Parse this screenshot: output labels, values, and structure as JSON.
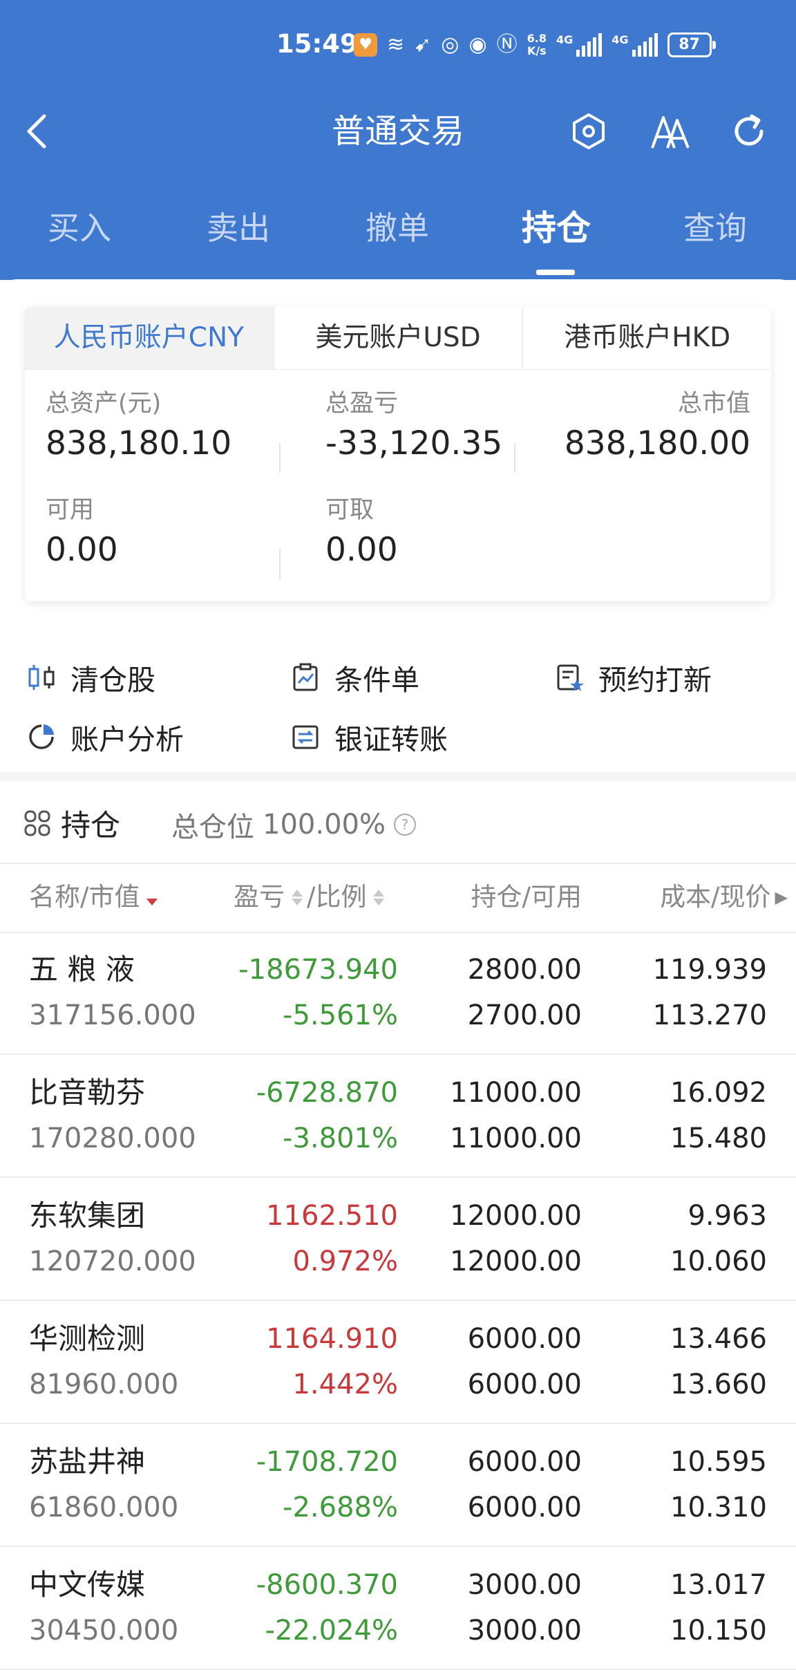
{
  "status_bar": {
    "time": "15:49",
    "net_speed_value": "6.8",
    "net_speed_unit": "K/s",
    "net_4g_1": "4G",
    "net_4g_2": "4G",
    "battery": "87"
  },
  "header": {
    "title": "普通交易"
  },
  "tabs": [
    {
      "label": "买入",
      "active": false
    },
    {
      "label": "卖出",
      "active": false
    },
    {
      "label": "撤单",
      "active": false
    },
    {
      "label": "持仓",
      "active": true
    },
    {
      "label": "查询",
      "active": false
    }
  ],
  "account_tabs": [
    {
      "label": "人民币账户CNY",
      "active": true
    },
    {
      "label": "美元账户USD",
      "active": false
    },
    {
      "label": "港币账户HKD",
      "active": false
    }
  ],
  "summary": {
    "total_assets_label": "总资产(元)",
    "total_assets": "838,180.10",
    "total_pl_label": "总盈亏",
    "total_pl": "-33,120.35",
    "market_value_label": "总市值",
    "market_value": "838,180.00",
    "available_label": "可用",
    "available": "0.00",
    "withdrawable_label": "可取",
    "withdrawable": "0.00"
  },
  "shortcuts": {
    "clear_stock": "清仓股",
    "conditional_order": "条件单",
    "ipo_subscribe": "预约打新",
    "account_analysis": "账户分析",
    "bank_transfer": "银证转账"
  },
  "positions": {
    "title": "持仓",
    "total_label": "总仓位",
    "total_value": "100.00%",
    "columns": {
      "name_mv": "名称/市值",
      "pl": "盈亏",
      "ratio": "/比例",
      "hold_avail": "持仓/可用",
      "cost_price": "成本/现价"
    },
    "rows": [
      {
        "name": "五 粮 液",
        "market_value": "317156.000",
        "pl": "-18673.940",
        "pct": "-5.561%",
        "hold": "2800.00",
        "avail": "2700.00",
        "cost": "119.939",
        "price": "113.270",
        "sign": "neg"
      },
      {
        "name": "比音勒芬",
        "market_value": "170280.000",
        "pl": "-6728.870",
        "pct": "-3.801%",
        "hold": "11000.00",
        "avail": "11000.00",
        "cost": "16.092",
        "price": "15.480",
        "sign": "neg"
      },
      {
        "name": "东软集团",
        "market_value": "120720.000",
        "pl": "1162.510",
        "pct": "0.972%",
        "hold": "12000.00",
        "avail": "12000.00",
        "cost": "9.963",
        "price": "10.060",
        "sign": "pos"
      },
      {
        "name": "华测检测",
        "market_value": "81960.000",
        "pl": "1164.910",
        "pct": "1.442%",
        "hold": "6000.00",
        "avail": "6000.00",
        "cost": "13.466",
        "price": "13.660",
        "sign": "pos"
      },
      {
        "name": "苏盐井神",
        "market_value": "61860.000",
        "pl": "-1708.720",
        "pct": "-2.688%",
        "hold": "6000.00",
        "avail": "6000.00",
        "cost": "10.595",
        "price": "10.310",
        "sign": "neg"
      },
      {
        "name": "中文传媒",
        "market_value": "30450.000",
        "pl": "-8600.370",
        "pct": "-22.024%",
        "hold": "3000.00",
        "avail": "3000.00",
        "cost": "13.017",
        "price": "10.150",
        "sign": "neg"
      }
    ]
  },
  "colors": {
    "brand": "#3f78cf",
    "loss": "#3f9a3a",
    "gain": "#c9383a"
  }
}
